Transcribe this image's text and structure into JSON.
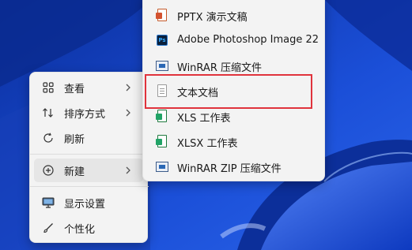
{
  "context_menu": {
    "items": [
      {
        "label": "查看",
        "icon": "grid-icon",
        "has_submenu": true
      },
      {
        "label": "排序方式",
        "icon": "sort-icon",
        "has_submenu": true
      },
      {
        "label": "刷新",
        "icon": "refresh-icon",
        "has_submenu": false
      },
      {
        "label": "新建",
        "icon": "new-plus-icon",
        "has_submenu": true,
        "active": true
      },
      {
        "label": "显示设置",
        "icon": "display-icon",
        "has_submenu": false
      },
      {
        "label": "个性化",
        "icon": "brush-icon",
        "has_submenu": false
      }
    ]
  },
  "new_submenu": {
    "items": [
      {
        "label": "PPTX 演示文稿",
        "icon": "pptx-file-icon"
      },
      {
        "label": "Adobe Photoshop Image 22",
        "icon": "photoshop-file-icon",
        "icon_text": "Ps"
      },
      {
        "label": "WinRAR 压缩文件",
        "icon": "winrar-file-icon"
      },
      {
        "label": "文本文档",
        "icon": "text-file-icon",
        "highlighted": true
      },
      {
        "label": "XLS 工作表",
        "icon": "xls-file-icon"
      },
      {
        "label": "XLSX 工作表",
        "icon": "xlsx-file-icon"
      },
      {
        "label": "WinRAR ZIP 压缩文件",
        "icon": "winrar-zip-file-icon"
      }
    ]
  },
  "colors": {
    "highlight_border": "#e0333c",
    "menu_bg": "#f3f3f3",
    "wallpaper": "#1e4fd0"
  }
}
